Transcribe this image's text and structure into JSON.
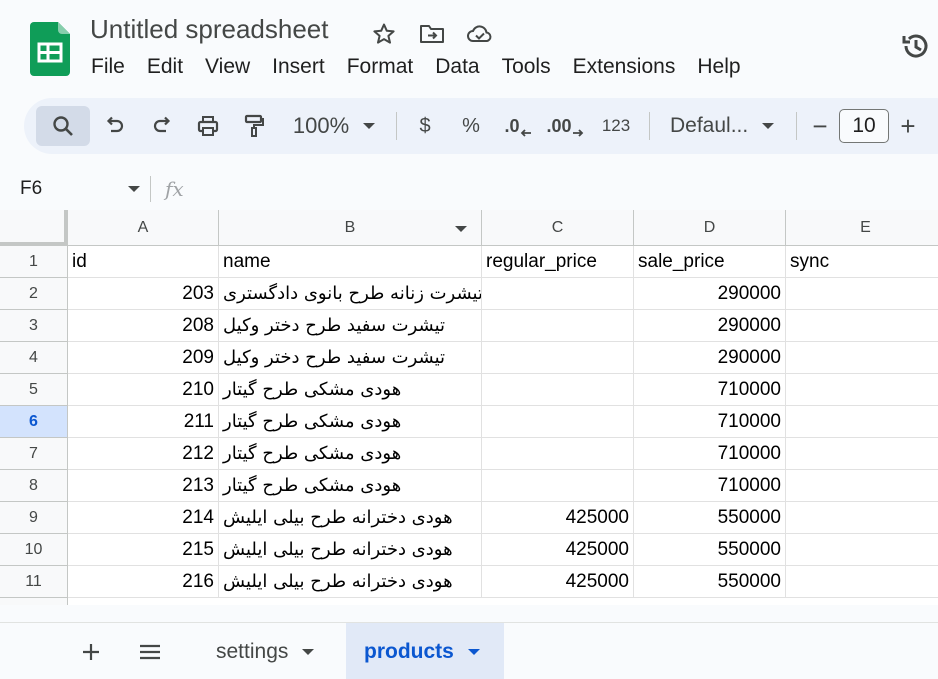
{
  "doc": {
    "title": "Untitled spreadsheet"
  },
  "menu": [
    "File",
    "Edit",
    "View",
    "Insert",
    "Format",
    "Data",
    "Tools",
    "Extensions",
    "Help"
  ],
  "toolbar": {
    "zoom": "100%",
    "currency": "$",
    "percent": "%",
    "decrease_decimal": ".0",
    "increase_decimal": ".00",
    "number_format": "123",
    "font": "Defaul...",
    "font_size": "10",
    "minus": "−",
    "plus": "+"
  },
  "formula_bar": {
    "cell_ref": "F6",
    "fx": "fx"
  },
  "columns": [
    "A",
    "B",
    "C",
    "D",
    "E"
  ],
  "rows": [
    {
      "num": "1",
      "a": "id",
      "b": "name",
      "c": "regular_price",
      "d": "sale_price",
      "e": "sync"
    },
    {
      "num": "2",
      "a": "203",
      "b": "تیشرت زنانه طرح بانوی دادگستری",
      "c": "",
      "d": "290000",
      "e": ""
    },
    {
      "num": "3",
      "a": "208",
      "b": "تیشرت سفید طرح دختر وکیل",
      "c": "",
      "d": "290000",
      "e": ""
    },
    {
      "num": "4",
      "a": "209",
      "b": "تیشرت سفید طرح دختر وکیل",
      "c": "",
      "d": "290000",
      "e": ""
    },
    {
      "num": "5",
      "a": "210",
      "b": "هودی مشکی طرح گیتار",
      "c": "",
      "d": "710000",
      "e": ""
    },
    {
      "num": "6",
      "a": "211",
      "b": "هودی مشکی طرح گیتار",
      "c": "",
      "d": "710000",
      "e": ""
    },
    {
      "num": "7",
      "a": "212",
      "b": "هودی مشکی طرح گیتار",
      "c": "",
      "d": "710000",
      "e": ""
    },
    {
      "num": "8",
      "a": "213",
      "b": "هودی مشکی طرح گیتار",
      "c": "",
      "d": "710000",
      "e": ""
    },
    {
      "num": "9",
      "a": "214",
      "b": "هودی دخترانه طرح بیلی ایلیش",
      "c": "425000",
      "d": "550000",
      "e": ""
    },
    {
      "num": "10",
      "a": "215",
      "b": "هودی دخترانه طرح بیلی ایلیش",
      "c": "425000",
      "d": "550000",
      "e": ""
    },
    {
      "num": "11",
      "a": "216",
      "b": "هودی دخترانه طرح بیلی ایلیش",
      "c": "425000",
      "d": "550000",
      "e": ""
    }
  ],
  "active_row": "6",
  "sheets": [
    {
      "name": "settings",
      "active": false
    },
    {
      "name": "products",
      "active": true
    }
  ],
  "colors": {
    "accent": "#0b57d0",
    "logo_green": "#0f9d58",
    "toolbar_bg": "#edf2fa"
  }
}
